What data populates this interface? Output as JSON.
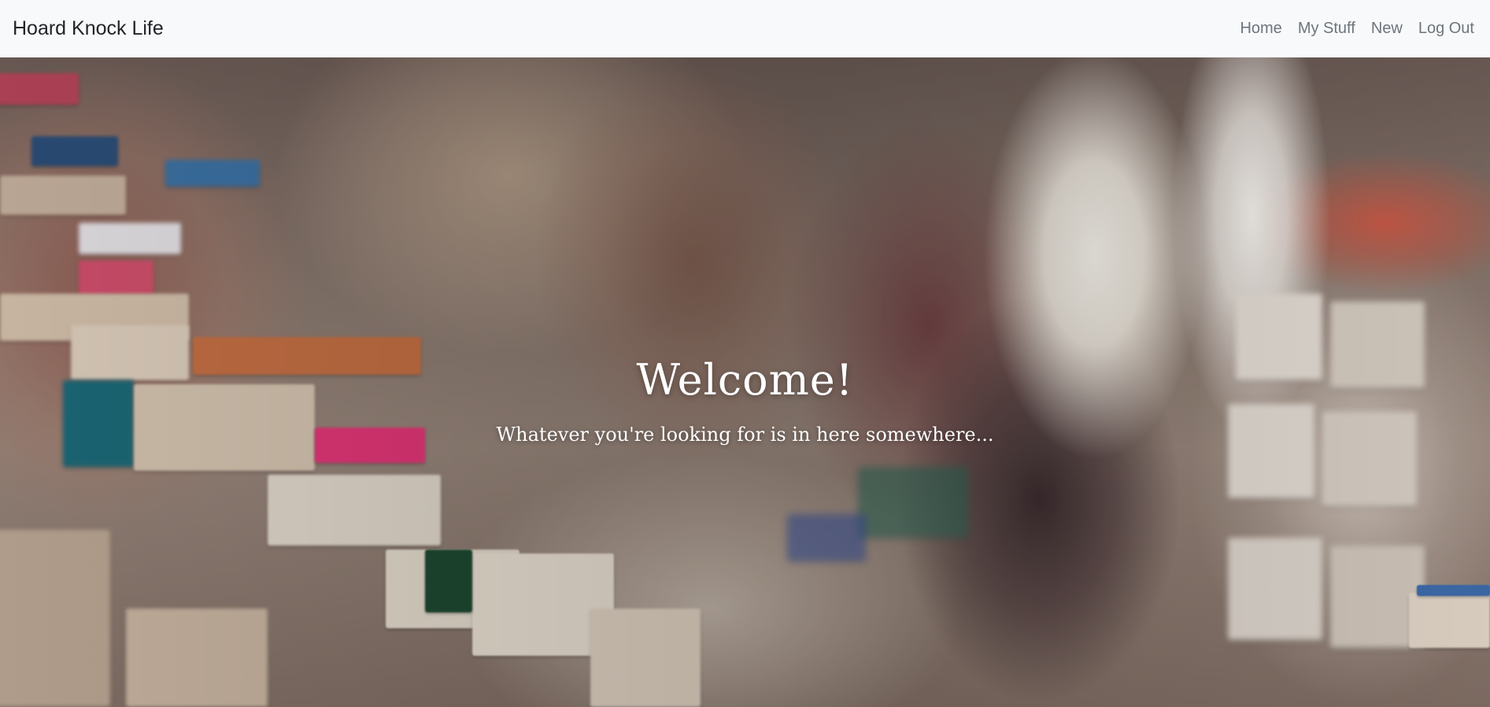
{
  "navbar": {
    "brand": "Hoard Knock Life",
    "links": [
      {
        "label": "Home"
      },
      {
        "label": "My Stuff"
      },
      {
        "label": "New"
      },
      {
        "label": "Log Out"
      }
    ]
  },
  "hero": {
    "title": "Welcome!",
    "subtitle": "Whatever you're looking for is in here somewhere..."
  },
  "colors": {
    "navbar_bg": "#f8f9fa",
    "brand_text": "#212529",
    "nav_link": "#6c757d",
    "hero_text": "#ffffff"
  },
  "icons": {
    "hero_background": "blurred-bookshop-photo"
  }
}
